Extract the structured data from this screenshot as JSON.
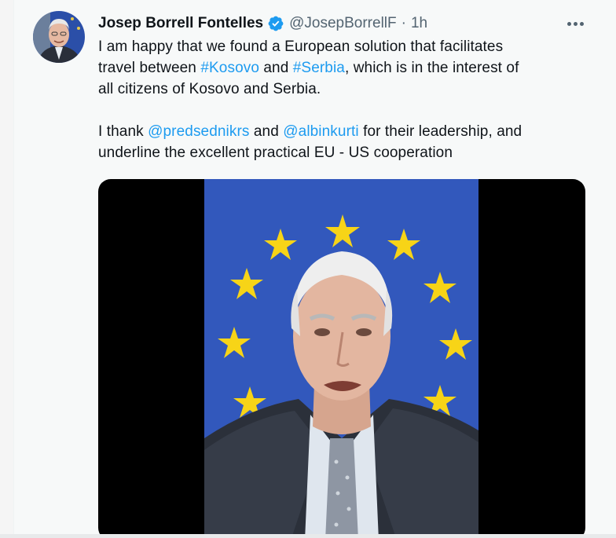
{
  "tweet": {
    "author": {
      "display_name": "Josep Borrell Fontelles",
      "handle": "@JosepBorrellF",
      "separator": "·",
      "time": "1h",
      "verified": true,
      "avatar_icon": "profile-photo"
    },
    "text": {
      "p1_l1": "I am happy that we found a European solution that facilitates",
      "p1_l2_a": "travel between ",
      "hashtag_1": "#Kosovo",
      "p1_l2_b": " and ",
      "hashtag_2": "#Serbia",
      "p1_l2_c": ", which is in the interest of",
      "p1_l3": "all citizens of Kosovo and Serbia.",
      "p2_l1_a": "I thank ",
      "mention_1": "@predsednikrs",
      "p2_l1_b": " and ",
      "mention_2": "@albinkurti",
      "p2_l1_c": " for their leadership, and",
      "p2_l2": "underline the excellent practical EU - US cooperation"
    },
    "media": {
      "type": "video"
    },
    "more_icon": "more-horizontal-icon"
  },
  "colors": {
    "background": "#f7f9f9",
    "text": "#0f1419",
    "secondary": "#536471",
    "link": "#1d9bf0",
    "verified_badge": "#1d9bf0",
    "eu_blue": "#2e54b8",
    "eu_star": "#f7d417"
  }
}
